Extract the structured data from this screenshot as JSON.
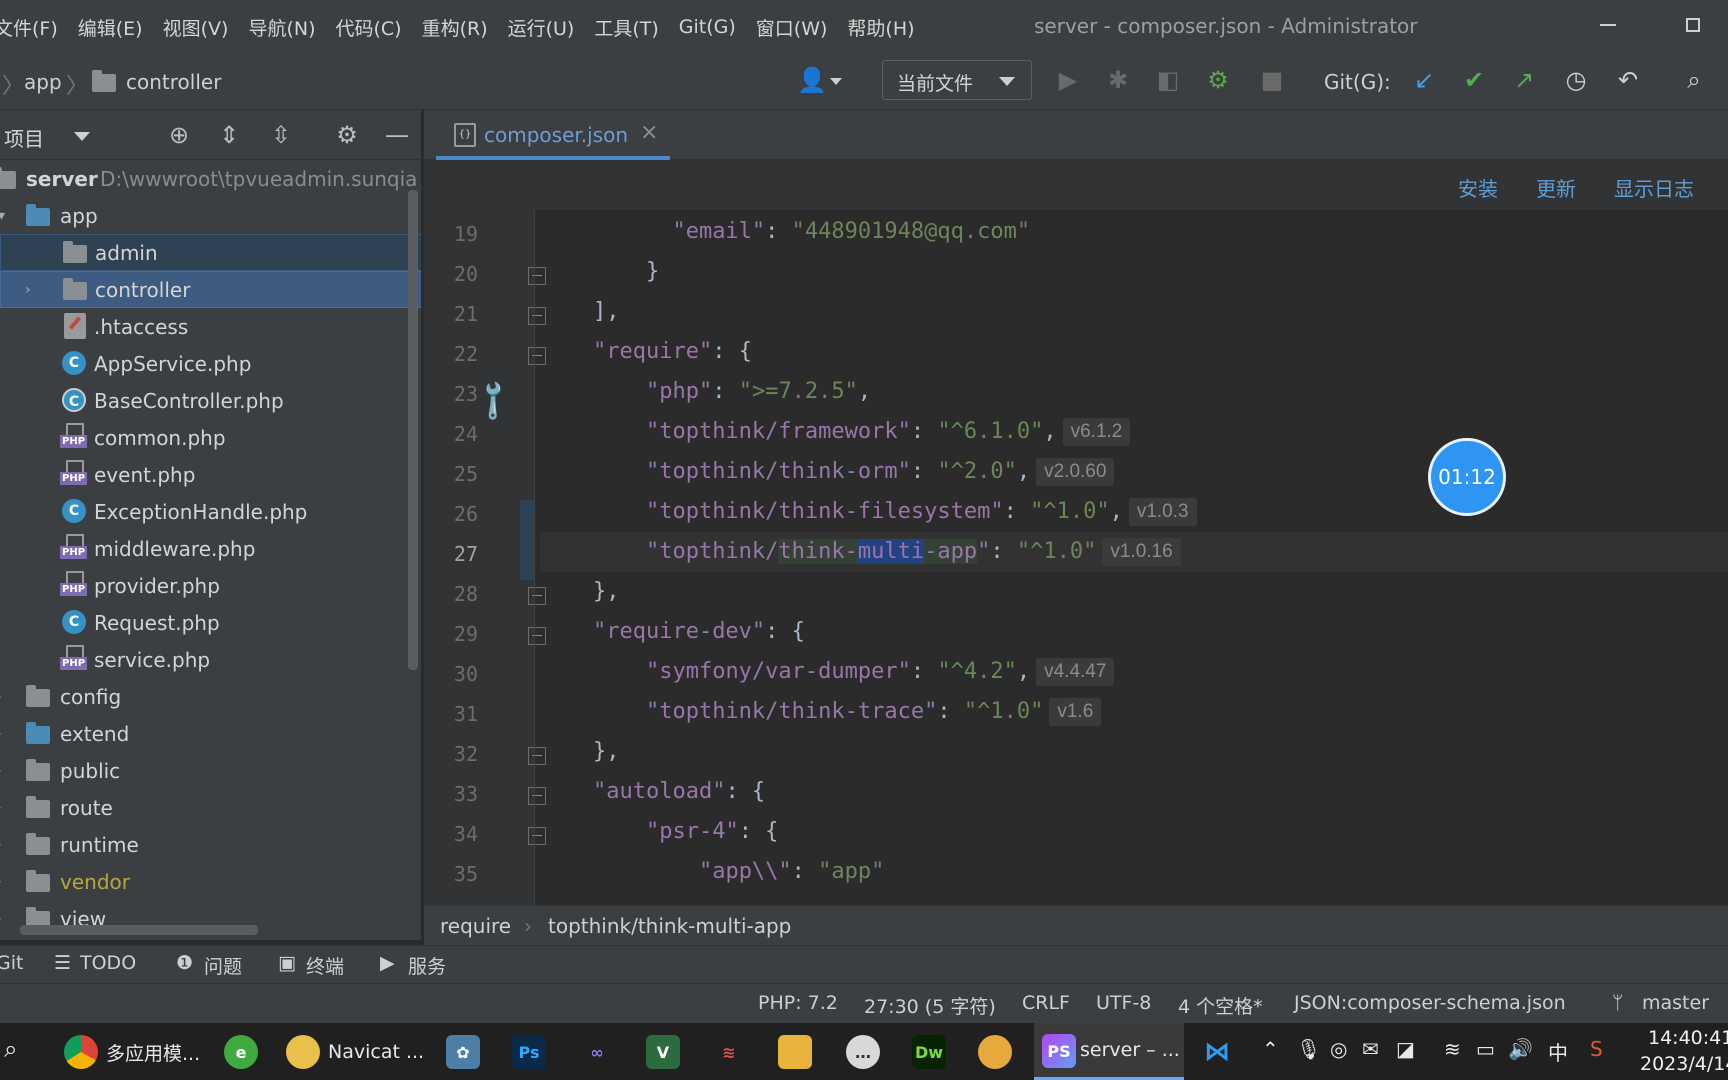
{
  "menu": [
    "文件(F)",
    "编辑(E)",
    "视图(V)",
    "导航(N)",
    "代码(C)",
    "重构(R)",
    "运行(U)",
    "工具(T)",
    "Git(G)",
    "窗口(W)",
    "帮助(H)"
  ],
  "window_title": "server - composer.json - Administrator",
  "nav": {
    "crumbs": [
      "app",
      "controller"
    ],
    "run_config": "当前文件",
    "git_label": "Git(G):"
  },
  "project": {
    "title": "项目",
    "root": {
      "name": "server",
      "path": "D:\\wwwroot\\tpvueadmin.sunqia"
    },
    "items": [
      {
        "label": "app"
      },
      {
        "label": "admin"
      },
      {
        "label": "controller"
      },
      {
        "label": ".htaccess"
      },
      {
        "label": "AppService.php"
      },
      {
        "label": "BaseController.php"
      },
      {
        "label": "common.php"
      },
      {
        "label": "event.php"
      },
      {
        "label": "ExceptionHandle.php"
      },
      {
        "label": "middleware.php"
      },
      {
        "label": "provider.php"
      },
      {
        "label": "Request.php"
      },
      {
        "label": "service.php"
      },
      {
        "label": "config"
      },
      {
        "label": "extend"
      },
      {
        "label": "public"
      },
      {
        "label": "route"
      },
      {
        "label": "runtime"
      },
      {
        "label": "vendor"
      },
      {
        "label": "view"
      }
    ]
  },
  "editor": {
    "tab": "composer.json",
    "composer_actions": [
      "安装",
      "更新",
      "显示日志"
    ],
    "line_numbers": [
      "19",
      "20",
      "21",
      "22",
      "23",
      "24",
      "25",
      "26",
      "27",
      "28",
      "29",
      "30",
      "31",
      "32",
      "33",
      "34",
      "35"
    ],
    "hints": {
      "framework": "v6.1.2",
      "orm": "v2.0.60",
      "filesystem": "v1.0.3",
      "multi_app": "v1.0.16",
      "var_dumper": "v4.4.47",
      "trace": "v1.6"
    },
    "timer": "01:12",
    "breadcrumb": [
      "require",
      "topthink/think-multi-app"
    ]
  },
  "tool_windows": [
    "Git",
    "TODO",
    "问题",
    "终端",
    "服务"
  ],
  "status": {
    "php": "PHP: 7.2",
    "position": "27:30 (5 字符)",
    "line_sep": "CRLF",
    "encoding": "UTF-8",
    "indent": "4 个空格*",
    "schema": "JSON:composer-schema.json",
    "branch": "master"
  },
  "taskbar": {
    "chrome": "多应用模...",
    "navicat": "Navicat ...",
    "phpstorm": "server – ...",
    "ime": "中",
    "time": "14:40:41",
    "date": "2023/4/14"
  }
}
